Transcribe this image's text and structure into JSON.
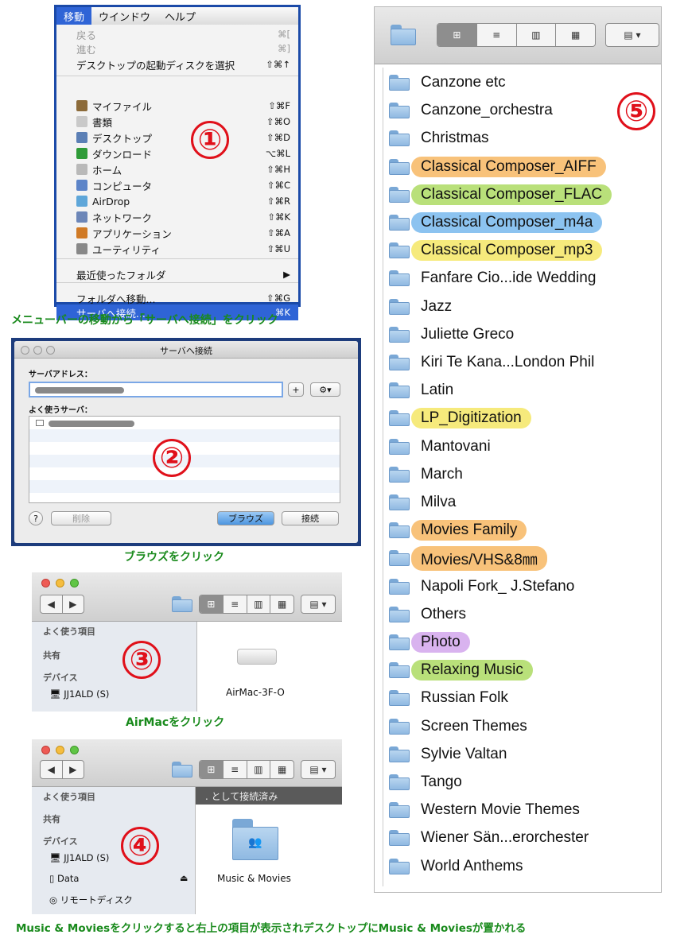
{
  "go_menu": {
    "menubar": [
      "移動",
      "ウインドウ",
      "ヘルプ"
    ],
    "items": [
      {
        "label": "戻る",
        "shortcut": "⌘[",
        "disabled": true
      },
      {
        "label": "進む",
        "shortcut": "⌘]",
        "disabled": true
      },
      {
        "label": "デスクトップの起動ディスクを選択",
        "shortcut": "⇧⌘↑"
      },
      {
        "label": "マイファイル",
        "shortcut": "⇧⌘F",
        "icon": "my-files-icon"
      },
      {
        "label": "書類",
        "shortcut": "⇧⌘O",
        "icon": "documents-icon"
      },
      {
        "label": "デスクトップ",
        "shortcut": "⇧⌘D",
        "icon": "desktop-icon"
      },
      {
        "label": "ダウンロード",
        "shortcut": "⌥⌘L",
        "icon": "download-icon"
      },
      {
        "label": "ホーム",
        "shortcut": "⇧⌘H",
        "icon": "home-icon"
      },
      {
        "label": "コンピュータ",
        "shortcut": "⇧⌘C",
        "icon": "computer-icon"
      },
      {
        "label": "AirDrop",
        "shortcut": "⇧⌘R",
        "icon": "airdrop-icon"
      },
      {
        "label": "ネットワーク",
        "shortcut": "⇧⌘K",
        "icon": "network-icon"
      },
      {
        "label": "アプリケーション",
        "shortcut": "⇧⌘A",
        "icon": "applications-icon"
      },
      {
        "label": "ユーティリティ",
        "shortcut": "⇧⌘U",
        "icon": "utilities-icon"
      },
      {
        "label": "最近使ったフォルダ",
        "shortcut": "▶"
      },
      {
        "label": "フォルダへ移動...",
        "shortcut": "⇧⌘G"
      },
      {
        "label": "サーバへ接続...",
        "shortcut": "⌘K",
        "selected": true
      }
    ]
  },
  "step1_number": "①",
  "caption1": "メニューバーの移動から「サーバへ接続」をクリック",
  "connect_dialog": {
    "title": "サーバへ接続",
    "address_label": "サーバアドレス：",
    "favorites_label": "よく使うサーバ：",
    "add_button": "+",
    "delete_button": "削除",
    "browse_button": "ブラウズ",
    "connect_button": "接続",
    "help_button": "?"
  },
  "step2_number": "②",
  "caption2": "ブラウズをクリック",
  "finder3": {
    "sidebar": [
      "よく使う項目",
      "共有",
      "デバイス",
      "JJ1ALD (S)"
    ],
    "item_label": "AirMac-3F-O"
  },
  "step3_number": "③",
  "caption3": "AirMacをクリック",
  "finder4": {
    "sidebar_heads": [
      "よく使う項目",
      "共有",
      "デバイス"
    ],
    "devices": [
      "JJ1ALD (S)",
      "Data",
      "リモートディスク"
    ],
    "status_bar": ". として接続済み",
    "item_label": "Music & Movies"
  },
  "step4_number": "④",
  "caption4": "Music & Moviesをクリックすると右上の項目が表示されデスクトップにMusic & Moviesが置かれる",
  "step5_number": "⑤",
  "folder_list": [
    {
      "name": "Canzone etc",
      "tag": ""
    },
    {
      "name": "Canzone_orchestra",
      "tag": ""
    },
    {
      "name": "Christmas",
      "tag": ""
    },
    {
      "name": "Classical Composer_AIFF",
      "tag": "#f8c27a"
    },
    {
      "name": "Classical Composer_FLAC",
      "tag": "#b9e07a"
    },
    {
      "name": "Classical Composer_m4a",
      "tag": "#8cc3f0"
    },
    {
      "name": "Classical Composer_mp3",
      "tag": "#f6ea7c"
    },
    {
      "name": "Fanfare Cio...ide Wedding",
      "tag": ""
    },
    {
      "name": "Jazz",
      "tag": ""
    },
    {
      "name": "Juliette Greco",
      "tag": ""
    },
    {
      "name": "Kiri Te Kana...London Phil",
      "tag": ""
    },
    {
      "name": "Latin",
      "tag": ""
    },
    {
      "name": "LP_Digitization",
      "tag": "#f6ea7c"
    },
    {
      "name": "Mantovani",
      "tag": ""
    },
    {
      "name": "March",
      "tag": ""
    },
    {
      "name": "Milva",
      "tag": ""
    },
    {
      "name": "Movies Family",
      "tag": "#f8c27a"
    },
    {
      "name": "Movies/VHS&8㎜",
      "tag": "#f8c27a"
    },
    {
      "name": "Napoli Fork_ J.Stefano",
      "tag": ""
    },
    {
      "name": "Others",
      "tag": ""
    },
    {
      "name": "Photo",
      "tag": "#d9b3ef"
    },
    {
      "name": "Relaxing Music",
      "tag": "#b9e07a"
    },
    {
      "name": "Russian Folk",
      "tag": ""
    },
    {
      "name": "Screen Themes",
      "tag": ""
    },
    {
      "name": "Sylvie Valtan",
      "tag": ""
    },
    {
      "name": "Tango",
      "tag": ""
    },
    {
      "name": "Western Movie Themes",
      "tag": ""
    },
    {
      "name": "Wiener Sän...erorchester",
      "tag": ""
    },
    {
      "name": "World Anthems",
      "tag": ""
    }
  ],
  "view_buttons": [
    "⊞",
    "≡",
    "▥",
    "▦"
  ],
  "arrange_button": "▤ ▾",
  "nav_back": "◀",
  "nav_forward": "▶"
}
